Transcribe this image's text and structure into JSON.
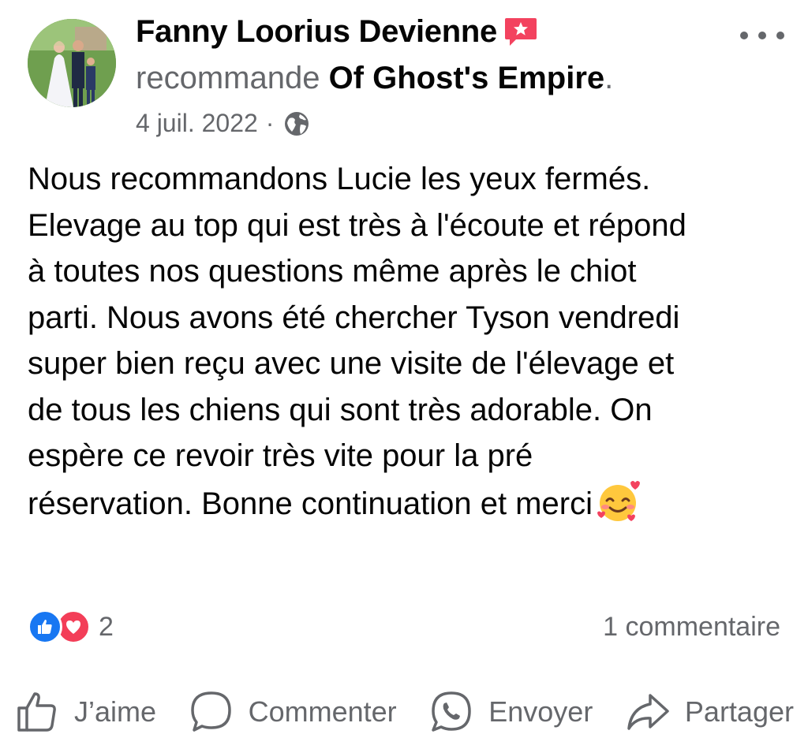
{
  "author": {
    "name": "Fanny Loorius Devienne",
    "badge_icon": "recommendation-badge-icon"
  },
  "recommendation": {
    "verb": "recommande",
    "page_name": "Of Ghost's Empire",
    "end": "."
  },
  "meta": {
    "date": "4 juil. 2022",
    "separator": "·",
    "privacy_icon": "globe-icon"
  },
  "post": {
    "text": "Nous recommandons Lucie les yeux fermés.\nElevage au top qui est très à l'écoute et répond\nà toutes nos questions même après le chiot\nparti. Nous avons été chercher Tyson vendredi\nsuper bien reçu avec une visite de l'élevage et\nde tous les chiens qui sont très adorable. On\nespère ce revoir très vite pour la pré\nréservation. Bonne continuation et merci",
    "emoji": "smiling-face-with-hearts"
  },
  "reactions": {
    "types": [
      "like",
      "love"
    ],
    "count": "2"
  },
  "comments": {
    "count_label": "1 commentaire"
  },
  "actions": {
    "like": "J’aime",
    "comment": "Commenter",
    "send": "Envoyer",
    "share": "Partager"
  },
  "colors": {
    "text_primary": "#050505",
    "text_secondary": "#65676b",
    "like_blue": "#1877f2",
    "love_red": "#f33e58",
    "badge_pink": "#f3425f"
  }
}
